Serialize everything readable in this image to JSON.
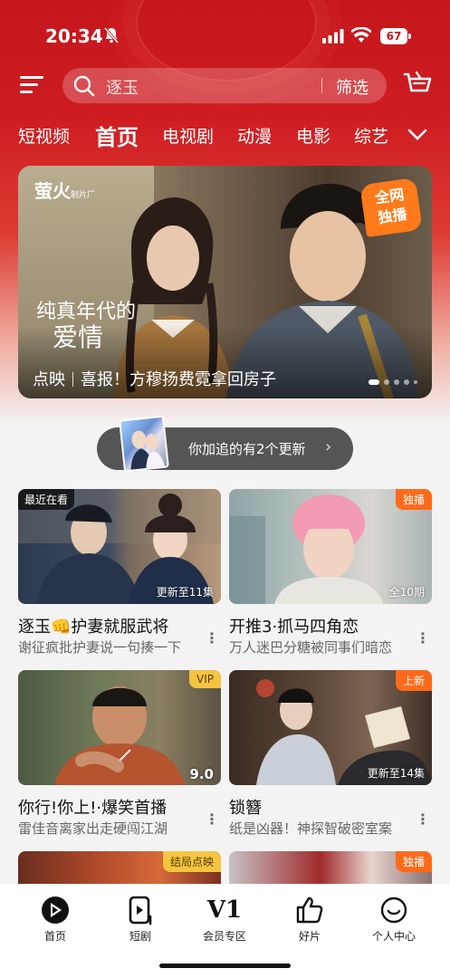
{
  "status": {
    "time": "20:34",
    "battery": "67"
  },
  "search": {
    "placeholder": "逐玉",
    "filter_label": "筛选"
  },
  "tabs": [
    {
      "label": "短视频",
      "active": false
    },
    {
      "label": "首页",
      "active": true
    },
    {
      "label": "电视剧",
      "active": false
    },
    {
      "label": "动漫",
      "active": false
    },
    {
      "label": "电影",
      "active": false
    },
    {
      "label": "综艺",
      "active": false
    }
  ],
  "banner": {
    "logo": "萤火",
    "logo_small": "制片厂",
    "badge_line1": "全网",
    "badge_line2": "独播",
    "calligraphy_line1": "纯真年代的",
    "calligraphy_line2": "爱情",
    "caption_prefix": "点映",
    "caption_text": "喜报！方穆扬费霓拿回房子",
    "slides": 5,
    "active_slide": 0
  },
  "follow": {
    "text": "你加追的有2个更新",
    "chevron": "›"
  },
  "cards": [
    {
      "title": "逐玉👊护妻就服武将",
      "subtitle": "谢征疯批护妻说一句揍一下",
      "top_left_badge": "最近在看",
      "top_right_badge": "",
      "bottom_right": "更新至11集",
      "score": "",
      "badge_color": ""
    },
    {
      "title": "开推3·抓马四角恋",
      "subtitle": "万人迷巴分糖被同事们暗恋",
      "top_left_badge": "",
      "top_right_badge": "独播",
      "bottom_right": "全10期",
      "score": "",
      "badge_color": "#ff6a1a"
    },
    {
      "title": "你行!你上!·爆笑首播",
      "subtitle": "雷佳音离家出走硬闯江湖",
      "top_left_badge": "",
      "top_right_badge": "VIP",
      "bottom_right": "",
      "score": "9.0",
      "badge_color": "#f5c542"
    },
    {
      "title": "锁簪",
      "subtitle": "纸是凶器！神探智破密室案",
      "top_left_badge": "",
      "top_right_badge": "上新",
      "bottom_right": "更新至14集",
      "score": "",
      "badge_color": "#ff6a1a"
    },
    {
      "title": "",
      "subtitle": "",
      "top_left_badge": "",
      "top_right_badge": "结局点映",
      "bottom_right": "",
      "score": "",
      "badge_color": "#f5c542"
    },
    {
      "title": "",
      "subtitle": "",
      "top_left_badge": "",
      "top_right_badge": "独播",
      "bottom_right": "",
      "score": "",
      "badge_color": "#ff6a1a"
    }
  ],
  "more_glyph": "⋮",
  "bottom_nav": [
    {
      "label": "首页",
      "icon": "play-logo-icon",
      "active": true
    },
    {
      "label": "短剧",
      "icon": "short-drama-icon",
      "active": false
    },
    {
      "label": "会员专区",
      "icon": "vip-v1-icon",
      "glyph": "V1",
      "active": false
    },
    {
      "label": "好片",
      "icon": "thumbs-up-icon",
      "active": false
    },
    {
      "label": "个人中心",
      "icon": "smiley-profile-icon",
      "active": false
    }
  ],
  "colors": {
    "brand_red": "#c4161c",
    "orange_badge": "#ff6a1a",
    "vip_gold": "#f5c542"
  }
}
